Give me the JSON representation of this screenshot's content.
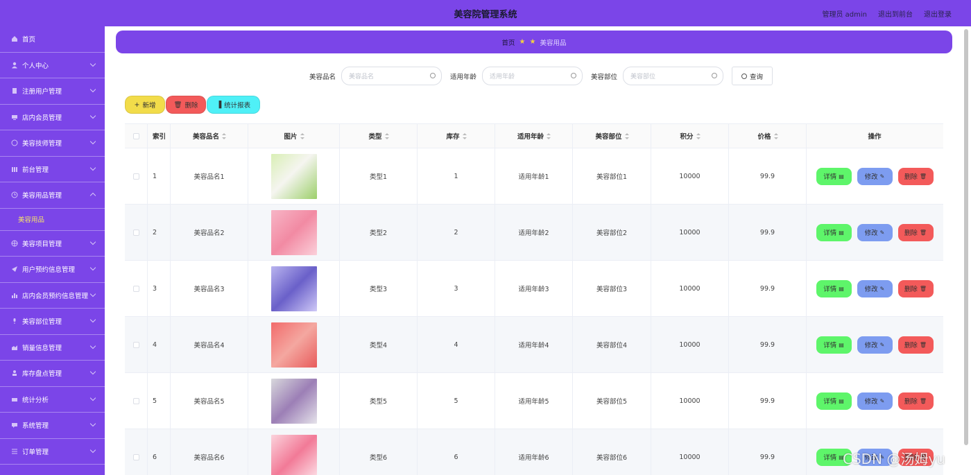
{
  "header": {
    "title": "美容院管理系统",
    "user_label": "管理员 admin",
    "back_front": "退出到前台",
    "logout": "退出登录"
  },
  "sidebar": {
    "items": [
      {
        "label": "首页",
        "icon": "home-icon",
        "expandable": false
      },
      {
        "label": "个人中心",
        "icon": "user-icon",
        "expandable": true
      },
      {
        "label": "注册用户管理",
        "icon": "doc-icon",
        "expandable": true
      },
      {
        "label": "店内会员管理",
        "icon": "monitor-icon",
        "expandable": true
      },
      {
        "label": "美容技师管理",
        "icon": "compass-icon",
        "expandable": true
      },
      {
        "label": "前台管理",
        "icon": "grid-icon",
        "expandable": true
      },
      {
        "label": "美容用品管理",
        "icon": "clock-icon",
        "expandable": true
      },
      {
        "label": "美容项目管理",
        "icon": "globe-icon",
        "expandable": true
      },
      {
        "label": "用户预约信息管理",
        "icon": "send-icon",
        "expandable": true
      },
      {
        "label": "店内会员预约信息管理",
        "icon": "bar-icon",
        "expandable": true
      },
      {
        "label": "美容部位管理",
        "icon": "mic-icon",
        "expandable": true
      },
      {
        "label": "销量信息管理",
        "icon": "chart-icon",
        "expandable": true
      },
      {
        "label": "库存盘点管理",
        "icon": "person-icon",
        "expandable": true
      },
      {
        "label": "统计分析",
        "icon": "keyboard-icon",
        "expandable": true
      },
      {
        "label": "系统管理",
        "icon": "message-icon",
        "expandable": true
      },
      {
        "label": "订单管理",
        "icon": "list-icon",
        "expandable": true
      }
    ],
    "active_sub": "美容用品"
  },
  "breadcrumb": {
    "home": "首页",
    "current": "美容用品"
  },
  "search": {
    "name_label": "美容品名",
    "name_placeholder": "美容品名",
    "age_label": "适用年龄",
    "age_placeholder": "适用年龄",
    "part_label": "美容部位",
    "part_placeholder": "美容部位",
    "query_label": "查询"
  },
  "toolbar": {
    "add_label": "新增",
    "delete_label": "删除",
    "stats_label": "统计报表"
  },
  "table": {
    "columns": [
      "索引",
      "美容品名",
      "图片",
      "类型",
      "库存",
      "适用年龄",
      "美容部位",
      "积分",
      "价格",
      "操作"
    ],
    "rows": [
      {
        "index": "1",
        "name": "美容品名1",
        "type": "类型1",
        "stock": "1",
        "age": "适用年龄1",
        "part": "美容部位1",
        "points": "10000",
        "price": "99.9"
      },
      {
        "index": "2",
        "name": "美容品名2",
        "type": "类型2",
        "stock": "2",
        "age": "适用年龄2",
        "part": "美容部位2",
        "points": "10000",
        "price": "99.9"
      },
      {
        "index": "3",
        "name": "美容品名3",
        "type": "类型3",
        "stock": "3",
        "age": "适用年龄3",
        "part": "美容部位3",
        "points": "10000",
        "price": "99.9"
      },
      {
        "index": "4",
        "name": "美容品名4",
        "type": "类型4",
        "stock": "4",
        "age": "适用年龄4",
        "part": "美容部位4",
        "points": "10000",
        "price": "99.9"
      },
      {
        "index": "5",
        "name": "美容品名5",
        "type": "类型5",
        "stock": "5",
        "age": "适用年龄5",
        "part": "美容部位5",
        "points": "10000",
        "price": "99.9"
      },
      {
        "index": "6",
        "name": "美容品名6",
        "type": "类型6",
        "stock": "6",
        "age": "适用年龄6",
        "part": "美容部位6",
        "points": "10000",
        "price": "99.9"
      }
    ],
    "op_detail": "详情",
    "op_edit": "修改",
    "op_delete": "删除"
  },
  "watermark": "CSDN @汤姆yu",
  "colors": {
    "primary": "#7b45e8",
    "add": "#f2dc4a",
    "delete": "#f35a5a",
    "stats": "#4ff0f7",
    "detail": "#5ef56a",
    "edit": "#7d9cf0"
  }
}
